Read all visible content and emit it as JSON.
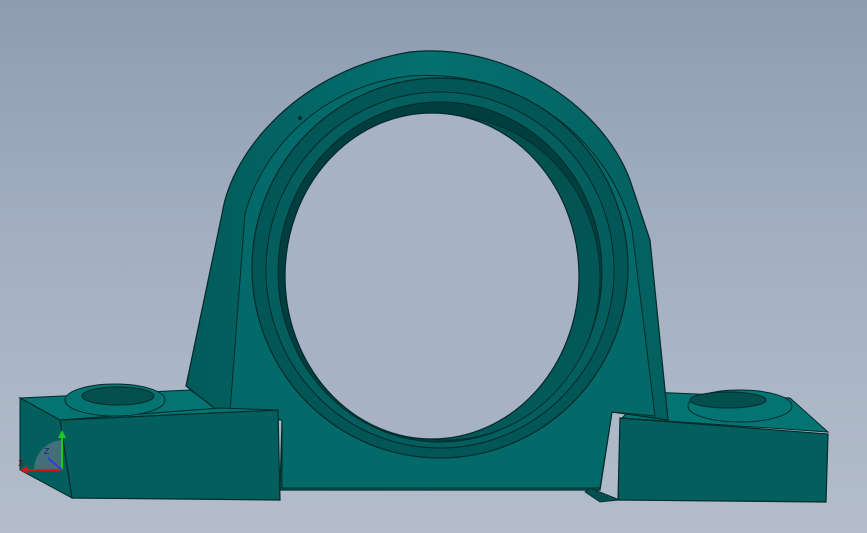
{
  "viewport": {
    "model_name": "pillow-block-bearing-housing",
    "background_top": "#8E9CB2",
    "background_bottom": "#B3BDCB",
    "body_color": "#036A6A",
    "body_dark": "#02504F",
    "body_darker": "#013E3E",
    "edge_color": "#012A2A"
  },
  "triad": {
    "x_label": "X",
    "y_label": "Y",
    "z_label": "Z",
    "x_color": "#D11A1A",
    "y_color": "#22C522",
    "z_color": "#2B3FD6"
  }
}
